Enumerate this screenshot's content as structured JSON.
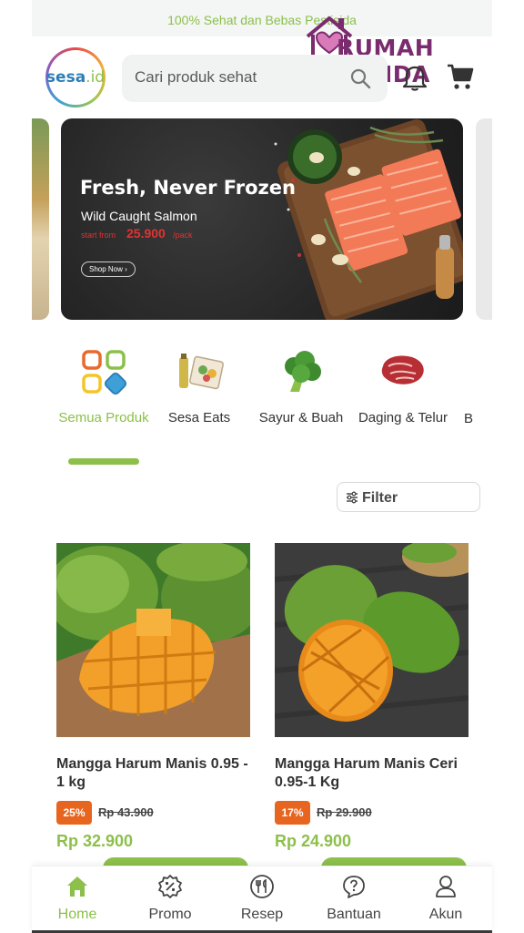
{
  "topbar": {
    "tagline": "100% Sehat dan Bebas Pestisida"
  },
  "watermark": {
    "text": "RUMAH BUNDA"
  },
  "logo": {
    "main": "sesa",
    "suffix": ".id"
  },
  "search": {
    "placeholder": "Cari produk sehat",
    "icon": "search-icon"
  },
  "header_icons": [
    "bell-icon",
    "cart-icon"
  ],
  "banner": {
    "title": "Fresh, Never Frozen",
    "subtitle": "Wild Caught Salmon",
    "price_prefix": "start from",
    "price": "25.900",
    "price_suffix": "/pack",
    "cta": "Shop Now ›"
  },
  "categories": [
    {
      "label": "Semua Produk",
      "icon": "all-products-icon",
      "active": true
    },
    {
      "label": "Sesa Eats",
      "icon": "meal-box-icon",
      "active": false
    },
    {
      "label": "Sayur & Buah",
      "icon": "broccoli-icon",
      "active": false
    },
    {
      "label": "Daging & Telur",
      "icon": "meat-icon",
      "active": false
    },
    {
      "label": "B",
      "icon": "",
      "active": false
    }
  ],
  "filter": {
    "label": "Filter",
    "icon": "filter-icon"
  },
  "products": [
    {
      "name": "Mangga Harum Manis 0.95 - 1 kg",
      "discount": "25%",
      "old_price": "Rp 43.900",
      "price": "Rp 32.900"
    },
    {
      "name": "Mangga Harum Manis Ceri 0.95-1 Kg",
      "discount": "17%",
      "old_price": "Rp 29.900",
      "price": "Rp 24.900"
    }
  ],
  "nav": [
    {
      "label": "Home",
      "icon": "home-icon",
      "active": true
    },
    {
      "label": "Promo",
      "icon": "promo-icon",
      "active": false
    },
    {
      "label": "Resep",
      "icon": "recipe-icon",
      "active": false
    },
    {
      "label": "Bantuan",
      "icon": "help-icon",
      "active": false
    },
    {
      "label": "Akun",
      "icon": "account-icon",
      "active": false
    }
  ],
  "colors": {
    "brand_green": "#8cc04b",
    "discount_orange": "#e8651f",
    "promo_red": "#e23232",
    "watermark_purple": "#7a2c6e"
  }
}
